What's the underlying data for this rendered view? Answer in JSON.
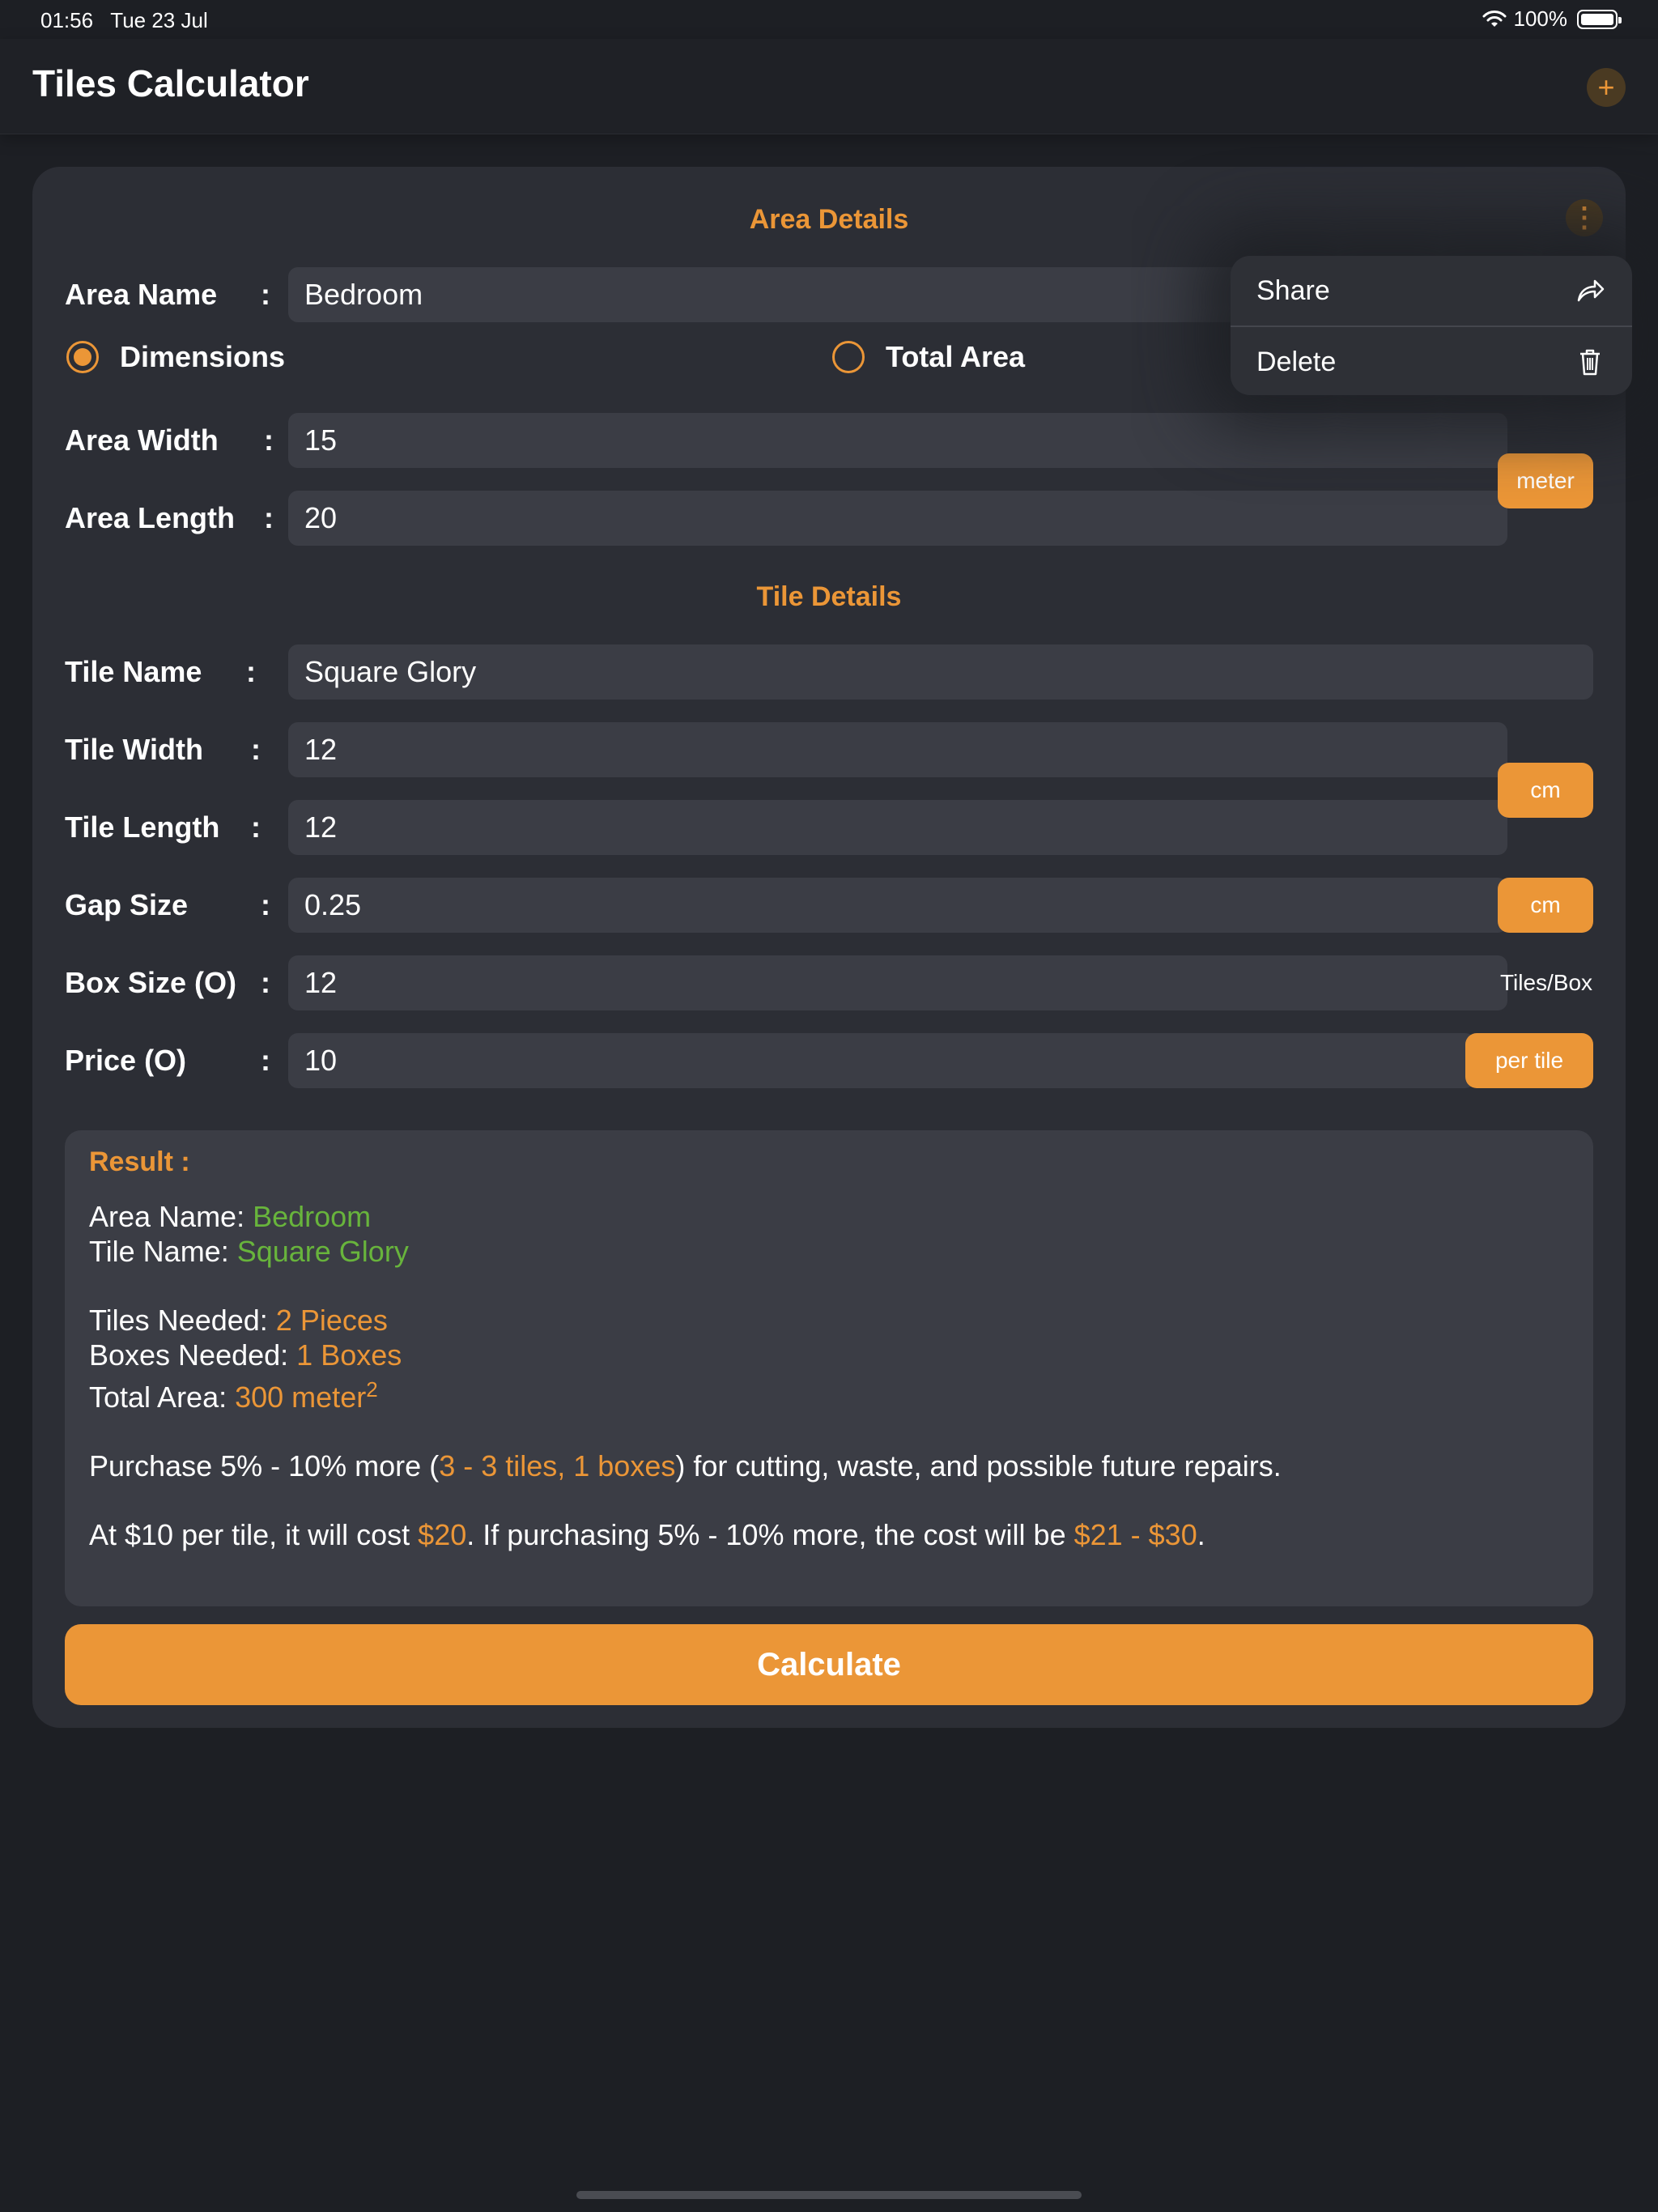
{
  "status_bar": {
    "time": "01:56",
    "date": "Tue 23 Jul",
    "battery": "100%"
  },
  "nav": {
    "title": "Tiles Calculator",
    "add_symbol": "+"
  },
  "area_details": {
    "title": "Area Details",
    "more_symbol": "⋮",
    "area_name_label": "Area Name",
    "area_name_value": "Bedroom",
    "radio_dimensions": "Dimensions",
    "radio_total_area": "Total Area",
    "selected_mode": "Dimensions",
    "width_label": "Area Width",
    "width_value": "15",
    "length_label": "Area Length",
    "length_value": "20",
    "unit": "meter"
  },
  "tile_details": {
    "title": "Tile Details",
    "name_label": "Tile Name",
    "name_value": "Square Glory",
    "width_label": "Tile Width",
    "width_value": "12",
    "length_label": "Tile Length",
    "length_value": "12",
    "tile_unit": "cm",
    "gap_label": "Gap Size",
    "gap_value": "0.25",
    "gap_unit": "cm",
    "box_label": "Box Size (O)",
    "box_value": "12",
    "box_unit": "Tiles/Box",
    "price_label": "Price (O)",
    "price_value": "10",
    "price_unit": "per tile"
  },
  "colon": ":",
  "result": {
    "title": "Result :",
    "area_name_prefix": "Area Name: ",
    "area_name": "Bedroom",
    "tile_name_prefix": "Tile Name: ",
    "tile_name": "Square Glory",
    "tiles_needed_prefix": "Tiles Needed: ",
    "tiles_needed": "2 Pieces",
    "boxes_needed_prefix": "Boxes Needed: ",
    "boxes_needed": "1 Boxes",
    "total_area_prefix": "Total Area: ",
    "total_area": "300 meter",
    "total_area_exponent": "2",
    "purchase_prefix": "Purchase 5% - 10% more (",
    "purchase_extra": "3 - 3 tiles, 1 boxes",
    "purchase_suffix": ") for cutting, waste, and possible future repairs.",
    "cost_prefix": "At $10 per tile, it will cost ",
    "cost_value": "$20",
    "cost_middle": ". If purchasing 5% - 10% more, the cost will be ",
    "cost_range": "$21 - $30",
    "cost_suffix": "."
  },
  "calculate_label": "Calculate",
  "menu": {
    "share_label": "Share",
    "delete_label": "Delete"
  },
  "colors": {
    "accent": "#eb9637",
    "highlight_green": "#68b43c",
    "background": "#1d1f24",
    "card": "#2c2e35"
  }
}
